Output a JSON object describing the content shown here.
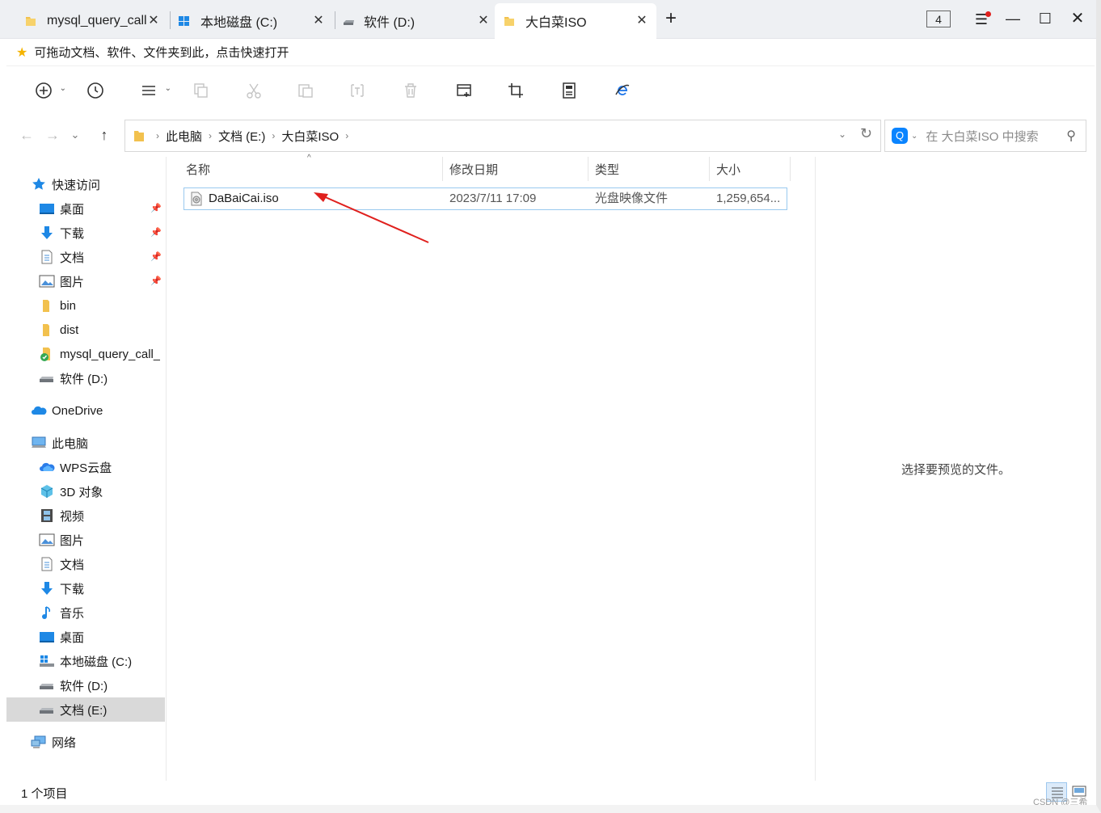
{
  "tabs": [
    {
      "label": "mysql_query_call",
      "icon": "folder-icon",
      "active": false
    },
    {
      "label": "本地磁盘 (C:)",
      "icon": "windows-drive-icon",
      "active": false
    },
    {
      "label": "软件 (D:)",
      "icon": "drive-icon",
      "active": false
    },
    {
      "label": "大白菜ISO",
      "icon": "folder-icon",
      "active": true
    }
  ],
  "window": {
    "count": "4"
  },
  "hint": {
    "text": "可拖动文档、软件、文件夹到此，点击快速打开"
  },
  "address": {
    "crumbs": [
      "此电脑",
      "文档 (E:)",
      "大白菜ISO"
    ],
    "search_placeholder": "在 大白菜ISO 中搜索"
  },
  "sidebar": {
    "quick_access": "快速访问",
    "items": [
      {
        "label": "桌面",
        "icon": "desktop-icon",
        "pinned": true
      },
      {
        "label": "下载",
        "icon": "download-icon",
        "pinned": true
      },
      {
        "label": "文档",
        "icon": "document-icon",
        "pinned": true
      },
      {
        "label": "图片",
        "icon": "picture-icon",
        "pinned": true
      },
      {
        "label": "bin",
        "icon": "folder-icon"
      },
      {
        "label": "dist",
        "icon": "folder-icon"
      },
      {
        "label": "mysql_query_call_",
        "icon": "sync-folder-icon"
      },
      {
        "label": "软件 (D:)",
        "icon": "drive-icon"
      }
    ],
    "onedrive": "OneDrive",
    "this_pc": "此电脑",
    "pc_items": [
      {
        "label": "WPS云盘",
        "icon": "cloud-icon"
      },
      {
        "label": "3D 对象",
        "icon": "cube-icon"
      },
      {
        "label": "视频",
        "icon": "video-icon"
      },
      {
        "label": "图片",
        "icon": "picture-icon"
      },
      {
        "label": "文档",
        "icon": "document-icon"
      },
      {
        "label": "下载",
        "icon": "download-icon"
      },
      {
        "label": "音乐",
        "icon": "music-icon"
      },
      {
        "label": "桌面",
        "icon": "desktop-icon"
      },
      {
        "label": "本地磁盘 (C:)",
        "icon": "windows-drive-icon"
      },
      {
        "label": "软件 (D:)",
        "icon": "drive-icon"
      },
      {
        "label": "文档 (E:)",
        "icon": "drive-icon",
        "selected": true
      }
    ],
    "network": "网络"
  },
  "columns": {
    "name": "名称",
    "modified": "修改日期",
    "type": "类型",
    "size": "大小"
  },
  "files": [
    {
      "name": "DaBaiCai.iso",
      "modified": "2023/7/11 17:09",
      "type": "光盘映像文件",
      "size": "1,259,654..."
    }
  ],
  "preview": {
    "text": "选择要预览的文件。"
  },
  "status": {
    "text": "1 个项目"
  },
  "watermark": "CSDN @三希",
  "colors": {
    "accent": "#0a84ff",
    "arrow": "#e0201d",
    "selection_border": "#99c9ef"
  }
}
